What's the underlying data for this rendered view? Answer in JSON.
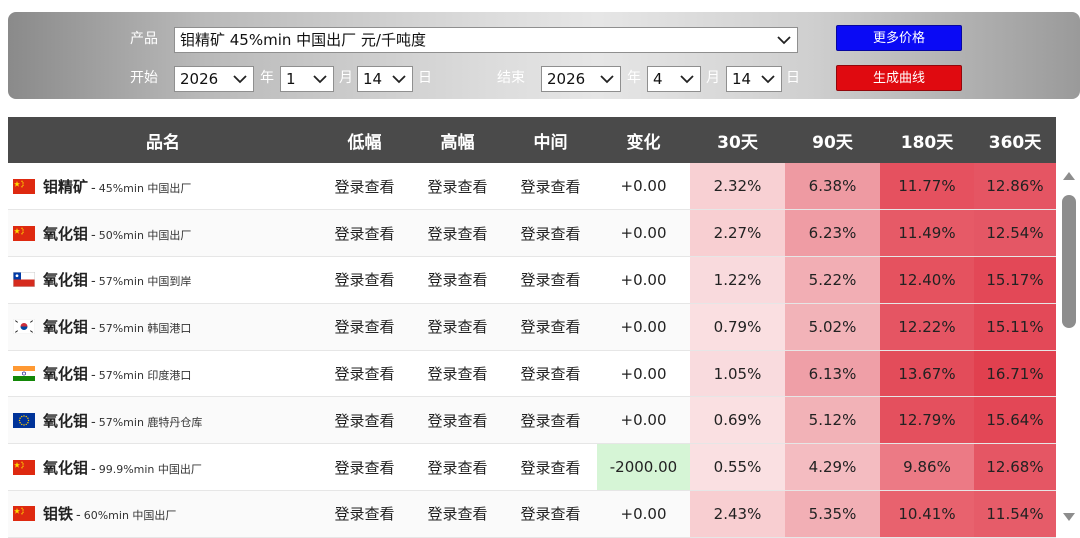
{
  "filter": {
    "product_label": "产品",
    "product_value": "钼精矿 45%min 中国出厂 元/千吨度",
    "start_label": "开始",
    "end_label": "结束",
    "year_unit": "年",
    "month_unit": "月",
    "day_unit": "日",
    "start": {
      "year": "2026",
      "month": "1",
      "day": "14"
    },
    "end": {
      "year": "2026",
      "month": "4",
      "day": "14"
    },
    "more_prices_button": "更多价格",
    "generate_curve_button": "生成曲线",
    "colors": {
      "more_prices": "#0a0af5",
      "generate_curve": "#e00a10"
    }
  },
  "table": {
    "columns": [
      "品名",
      "低幅",
      "高幅",
      "中间",
      "变化",
      "30天",
      "90天",
      "180天",
      "360天"
    ],
    "rows": [
      {
        "flag": "china-flag-icon",
        "name": "钼精矿",
        "desc": "45%min 中国出厂",
        "low": "登录查看",
        "high": "登录查看",
        "mid": "登录查看",
        "change": "+0.00",
        "d30": "2.32%",
        "d90": "6.38%",
        "d180": "11.77%",
        "d360": "12.86%"
      },
      {
        "flag": "china-flag-icon",
        "name": "氧化钼",
        "desc": "50%min 中国出厂",
        "low": "登录查看",
        "high": "登录查看",
        "mid": "登录查看",
        "change": "+0.00",
        "d30": "2.27%",
        "d90": "6.23%",
        "d180": "11.49%",
        "d360": "12.54%"
      },
      {
        "flag": "chile-flag-icon",
        "name": "氧化钼",
        "desc": "57%min 中国到岸",
        "low": "登录查看",
        "high": "登录查看",
        "mid": "登录查看",
        "change": "+0.00",
        "d30": "1.22%",
        "d90": "5.22%",
        "d180": "12.40%",
        "d360": "15.17%"
      },
      {
        "flag": "korea-flag-icon",
        "name": "氧化钼",
        "desc": "57%min 韩国港口",
        "low": "登录查看",
        "high": "登录查看",
        "mid": "登录查看",
        "change": "+0.00",
        "d30": "0.79%",
        "d90": "5.02%",
        "d180": "12.22%",
        "d360": "15.11%"
      },
      {
        "flag": "india-flag-icon",
        "name": "氧化钼",
        "desc": "57%min 印度港口",
        "low": "登录查看",
        "high": "登录查看",
        "mid": "登录查看",
        "change": "+0.00",
        "d30": "1.05%",
        "d90": "6.13%",
        "d180": "13.67%",
        "d360": "16.71%"
      },
      {
        "flag": "eu-flag-icon",
        "name": "氧化钼",
        "desc": "57%min 鹿特丹仓库",
        "low": "登录查看",
        "high": "登录查看",
        "mid": "登录查看",
        "change": "+0.00",
        "d30": "0.69%",
        "d90": "5.12%",
        "d180": "12.79%",
        "d360": "15.64%"
      },
      {
        "flag": "china-flag-icon",
        "name": "氧化钼",
        "desc": "99.9%min 中国出厂",
        "low": "登录查看",
        "high": "登录查看",
        "mid": "登录查看",
        "change": "-2000.00",
        "d30": "0.55%",
        "d90": "4.29%",
        "d180": "9.86%",
        "d360": "12.68%"
      },
      {
        "flag": "china-flag-icon",
        "name": "钼铁",
        "desc": "60%min 中国出厂",
        "low": "登录查看",
        "high": "登录查看",
        "mid": "登录查看",
        "change": "+0.00",
        "d30": "2.43%",
        "d90": "5.35%",
        "d180": "10.41%",
        "d360": "11.54%"
      }
    ],
    "heat_colors": {
      "d30": [
        "#f8d0d3",
        "#f8cfd2",
        "#f9dadd",
        "#fadfe1",
        "#f9dbde",
        "#fae0e2",
        "#fae0e2",
        "#f8ced1"
      ],
      "d90": [
        "#ee9aa2",
        "#ef9ca4",
        "#f2aeb4",
        "#f2b3b8",
        "#ef9fa7",
        "#f2b2b7",
        "#f4bcc1",
        "#f2afb5"
      ],
      "d180": [
        "#e5515f",
        "#e65a67",
        "#e5525f",
        "#e55563",
        "#e34c5a",
        "#e4505e",
        "#ec7a85",
        "#e8626e"
      ],
      "d360": [
        "#e55563",
        "#e45765",
        "#e34857",
        "#e34958",
        "#e1404f",
        "#e34756",
        "#e55664",
        "#e65c69"
      ]
    },
    "neg_color": "#d6f5d6"
  }
}
